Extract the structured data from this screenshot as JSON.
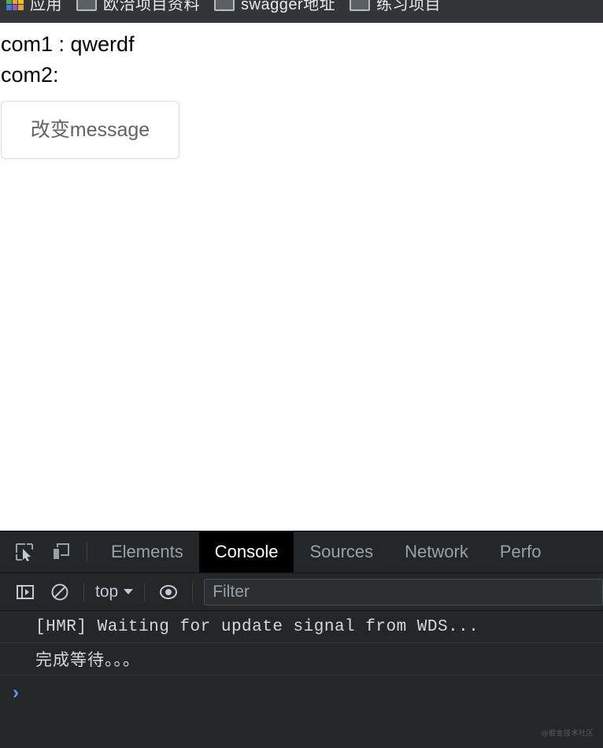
{
  "browser": {
    "bookmarks": [
      {
        "label": "应用",
        "icon": "apps-grid-icon"
      },
      {
        "label": "欧洽项目资料",
        "icon": "page-icon"
      },
      {
        "label": "swagger地址",
        "icon": "page-icon"
      },
      {
        "label": "练习项目",
        "icon": "page-icon"
      }
    ]
  },
  "page": {
    "line1": "com1 : qwerdf",
    "line2": "com2:",
    "button_label": "改变message"
  },
  "devtools": {
    "toolbar_icons": [
      {
        "name": "inspect-element-icon"
      },
      {
        "name": "device-toolbar-icon"
      }
    ],
    "tabs": [
      {
        "label": "Elements",
        "active": false
      },
      {
        "label": "Console",
        "active": true
      },
      {
        "label": "Sources",
        "active": false
      },
      {
        "label": "Network",
        "active": false
      },
      {
        "label": "Perfo",
        "active": false
      }
    ],
    "console_toolbar": {
      "sidebar_toggle_icon": "console-sidebar-icon",
      "clear_icon": "clear-console-icon",
      "context_label": "top",
      "eye_icon": "live-expression-eye-icon",
      "filter_placeholder": "Filter",
      "filter_value": ""
    },
    "messages": [
      {
        "text": "[HMR] Waiting for update signal from WDS...",
        "type": "mono"
      },
      {
        "text": "完成等待。。。",
        "type": "cjk"
      }
    ],
    "prompt": {
      "chevron": "›",
      "value": ""
    }
  },
  "watermark": {
    "text": "@掘金技术社区"
  },
  "colors": {
    "bookmark_bar_bg": "#323639",
    "devtools_bg": "#242729",
    "active_tab_bg": "#000000",
    "prompt_blue": "#5a9cf8",
    "tab_text": "#9aa0a6"
  }
}
